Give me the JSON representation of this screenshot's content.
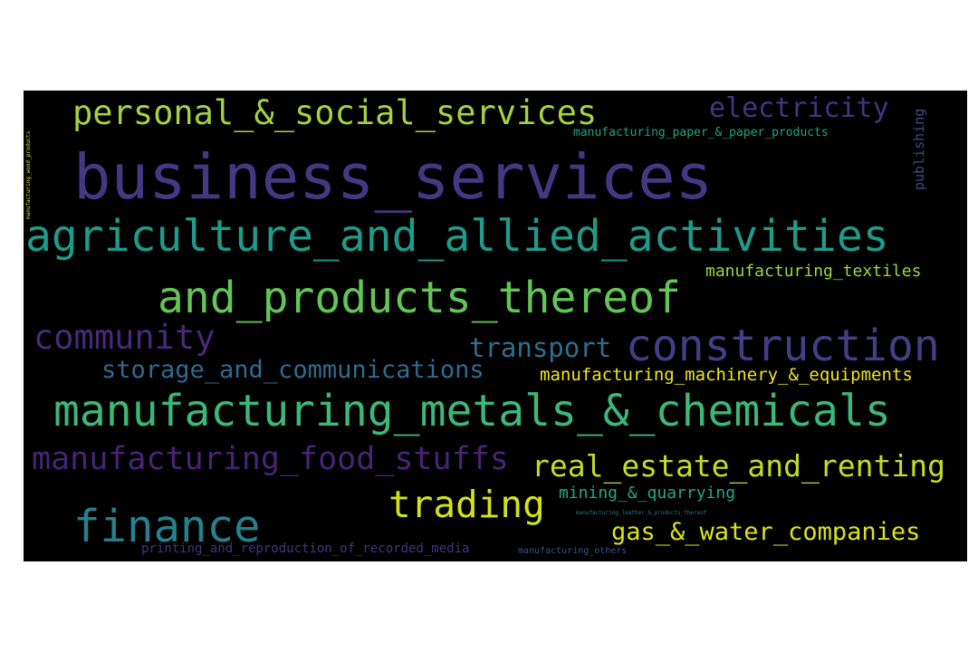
{
  "words": [
    {
      "text": "business_services",
      "color": "#453882"
    },
    {
      "text": "agriculture_and_allied_activities",
      "color": "#1e9b8a"
    },
    {
      "text": "manufacturing_metals_&_chemicals",
      "color": "#3cb878"
    },
    {
      "text": "and_products_thereof",
      "color": "#62c556"
    },
    {
      "text": "construction",
      "color": "#433e85"
    },
    {
      "text": "personal_&_social_services",
      "color": "#a5d33f"
    },
    {
      "text": "finance",
      "color": "#26818e"
    },
    {
      "text": "trading",
      "color": "#d4e21a"
    },
    {
      "text": "community",
      "color": "#472a7a"
    },
    {
      "text": "manufacturing_food_stuffs",
      "color": "#482475"
    },
    {
      "text": "real_estate_and_renting",
      "color": "#bfdf25"
    },
    {
      "text": "storage_and_communications",
      "color": "#2f6b8e"
    },
    {
      "text": "electricity",
      "color": "#453581"
    },
    {
      "text": "transport",
      "color": "#2e6f8e"
    },
    {
      "text": "gas_&_water_companies",
      "color": "#dde318"
    },
    {
      "text": "manufacturing_machinery_&_equipments",
      "color": "#f1e51d"
    },
    {
      "text": "manufacturing_textiles",
      "color": "#9bd93c"
    },
    {
      "text": "mining_&_quarrying",
      "color": "#22a884"
    },
    {
      "text": "manufacturing_paper_&_paper_products",
      "color": "#20a386"
    },
    {
      "text": "publishing",
      "color": "#3e4c8a"
    },
    {
      "text": "printing_and_reproduction_of_recorded_media",
      "color": "#46337e"
    },
    {
      "text": "manufacturing_others",
      "color": "#3a538b"
    },
    {
      "text": "manufacturing_leather_&_products_thereof",
      "color": "#2a788e"
    },
    {
      "text": "manufacturing_wood_products",
      "color": "#e0e319"
    }
  ]
}
